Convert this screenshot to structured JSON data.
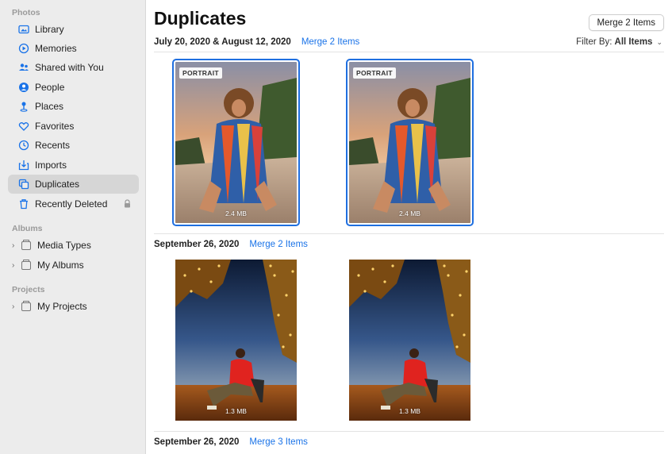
{
  "sidebar": {
    "photos_label": "Photos",
    "items": [
      {
        "label": "Library",
        "icon": "library-icon"
      },
      {
        "label": "Memories",
        "icon": "memories-icon"
      },
      {
        "label": "Shared with You",
        "icon": "shared-with-you-icon"
      },
      {
        "label": "People",
        "icon": "people-icon"
      },
      {
        "label": "Places",
        "icon": "places-icon"
      },
      {
        "label": "Favorites",
        "icon": "heart-icon"
      },
      {
        "label": "Recents",
        "icon": "clock-icon"
      },
      {
        "label": "Imports",
        "icon": "imports-icon"
      },
      {
        "label": "Duplicates",
        "icon": "duplicates-icon",
        "active": true
      },
      {
        "label": "Recently Deleted",
        "icon": "trash-icon"
      }
    ],
    "albums_label": "Albums",
    "albums": [
      {
        "label": "Media Types"
      },
      {
        "label": "My Albums"
      }
    ],
    "projects_label": "Projects",
    "projects": [
      {
        "label": "My Projects"
      }
    ]
  },
  "header": {
    "title": "Duplicates",
    "merge_button": "Merge 2 Items",
    "filter_label": "Filter By:",
    "filter_value": "All Items"
  },
  "groups": [
    {
      "date": "July 20, 2020 & August 12, 2020",
      "merge": "Merge 2 Items",
      "photos": [
        {
          "badge": "PORTRAIT",
          "size": "2.4 MB"
        },
        {
          "badge": "PORTRAIT",
          "size": "2.4 MB"
        }
      ]
    },
    {
      "date": "September 26, 2020",
      "merge": "Merge 2 Items",
      "photos": [
        {
          "size": "1.3 MB"
        },
        {
          "size": "1.3 MB"
        }
      ]
    },
    {
      "date": "September 26, 2020",
      "merge": "Merge 3 Items"
    }
  ],
  "colors": {
    "accent": "#1a73e8",
    "selection": "#1f6fe0",
    "sidebar_bg": "#ececec",
    "sidebar_active": "#d6d6d6"
  }
}
